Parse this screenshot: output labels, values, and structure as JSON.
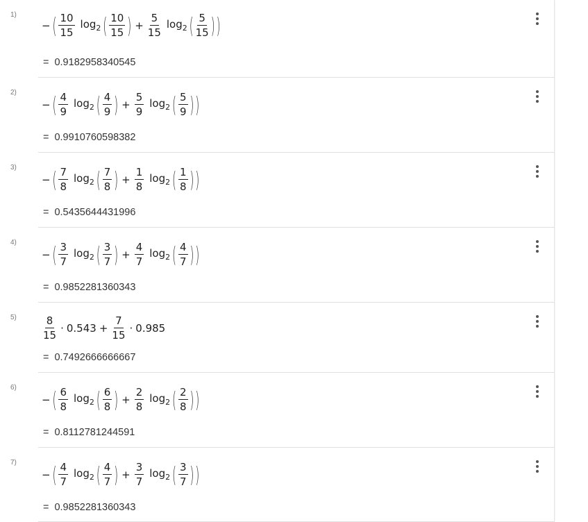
{
  "rows": [
    {
      "num": "1)",
      "a": {
        "n": "10",
        "d": "15"
      },
      "b": {
        "n": "5",
        "d": "15"
      },
      "result": "0.9182958340545"
    },
    {
      "num": "2)",
      "a": {
        "n": "4",
        "d": "9"
      },
      "b": {
        "n": "5",
        "d": "9"
      },
      "result": "0.9910760598382"
    },
    {
      "num": "3)",
      "a": {
        "n": "7",
        "d": "8"
      },
      "b": {
        "n": "1",
        "d": "8"
      },
      "result": "0.5435644431996"
    },
    {
      "num": "4)",
      "a": {
        "n": "3",
        "d": "7"
      },
      "b": {
        "n": "4",
        "d": "7"
      },
      "result": "0.9852281360343"
    },
    {
      "num": "5)",
      "weighted": {
        "f1": {
          "n": "8",
          "d": "15"
        },
        "v1": "0.543",
        "f2": {
          "n": "7",
          "d": "15"
        },
        "v2": "0.985"
      },
      "result": "0.7492666666667"
    },
    {
      "num": "6)",
      "a": {
        "n": "6",
        "d": "8"
      },
      "b": {
        "n": "2",
        "d": "8"
      },
      "result": "0.8112781244591"
    },
    {
      "num": "7)",
      "a": {
        "n": "4",
        "d": "7"
      },
      "b": {
        "n": "3",
        "d": "7"
      },
      "result": "0.9852281360343"
    }
  ],
  "symbols": {
    "minus": "−",
    "lparen": "(",
    "rparen": ")",
    "plus": "+",
    "dot": "·",
    "equals": "=",
    "log": "log",
    "base": "2"
  },
  "icons": {
    "menu": "more-vertical-icon"
  }
}
